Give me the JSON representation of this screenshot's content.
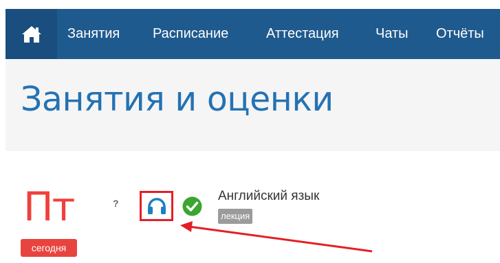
{
  "nav": {
    "home_icon": "home-icon",
    "items": [
      {
        "label": "Занятия"
      },
      {
        "label": "Расписание"
      },
      {
        "label": "Аттестация"
      },
      {
        "label": "Чаты"
      },
      {
        "label": "Отчёты"
      }
    ]
  },
  "page": {
    "title": "Занятия и оценки"
  },
  "day": {
    "label": "Пт",
    "badge": "сегодня"
  },
  "lesson": {
    "status_marker": "?",
    "media_icon": "headphones-icon",
    "status_icon": "checkmark-circle-icon",
    "subject": "Английский язык",
    "type": "лекция"
  },
  "colors": {
    "navbar": "#1f5a8e",
    "title": "#2472b3",
    "day": "#f0403c",
    "badge": "#e8443f",
    "highlight": "#e41e25",
    "check": "#3aa52f",
    "lesson_type_badge": "#9b9b9b"
  }
}
